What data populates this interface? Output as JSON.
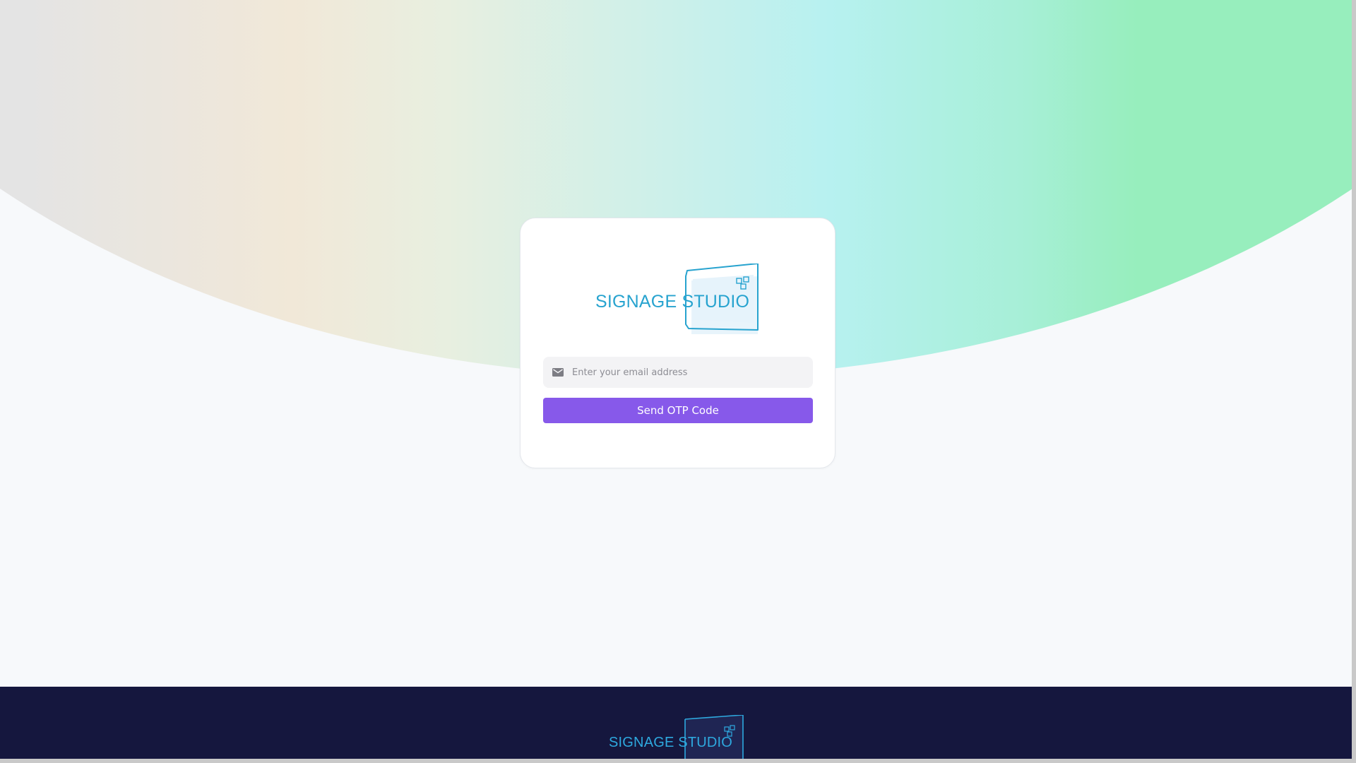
{
  "brand": {
    "logo_text": "SIGNAGE STUDIO"
  },
  "login": {
    "email_placeholder": "Enter your email address",
    "email_value": "",
    "send_button_label": "Send OTP Code"
  },
  "footer": {
    "logo_text": "SIGNAGE STUDIO"
  },
  "icons": {
    "email_field": "mail-icon",
    "logo_grid": "grid-squares-icon"
  },
  "colors": {
    "brand_blue": "#27a3cf",
    "button_purple": "#8759ea",
    "footer_navy": "#15173e",
    "page_bg": "#f7f9fb"
  }
}
